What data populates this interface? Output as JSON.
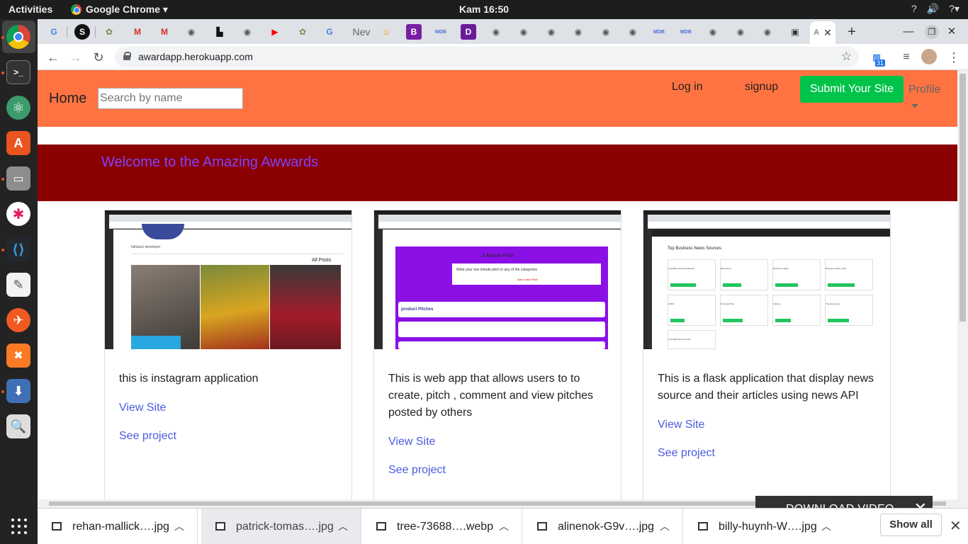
{
  "system": {
    "activities": "Activities",
    "app_name": "Google Chrome ▾",
    "clock": "Kam 16:50",
    "tray": [
      "?",
      "🔊",
      "?▾"
    ]
  },
  "browser": {
    "url": "awardapp.herokuapp.com",
    "tab_labels": [
      "G",
      "S",
      "M",
      "M",
      "G",
      "Nev",
      "B",
      "MDB",
      "MDB",
      "MDB"
    ],
    "badge": "31"
  },
  "page": {
    "nav": {
      "home": "Home",
      "search_placeholder": "Search by name",
      "login": "Log in",
      "signup": "signup",
      "submit": "Submit Your Site",
      "profile": "Profile"
    },
    "hero": {
      "welcome": "Welcome to the Amazing Awwards"
    },
    "projects": [
      {
        "description": "this is instagram application",
        "view_label": "View Site",
        "project_label": "See project",
        "thumb": {
          "all_posts": "All Posts",
          "subtitle": "fullstack developer"
        }
      },
      {
        "description": "This is web app that allows users to to create, pitch , comment and view pitches posted by others",
        "view_label": "View Site",
        "project_label": "See project",
        "thumb": {
          "title": "A Minute Pitch",
          "prompt": "Write your one minute pitch in any of the categories",
          "add": "Add a new Pitch",
          "section": "product Pitches"
        }
      },
      {
        "description": "This is a flask application that display news source and their articles using news API",
        "view_label": "View Site",
        "project_label": "See project",
        "thumb": {
          "title": "Top Business News Sources",
          "sources": [
            "Australian Financial Review",
            "Bloomberg",
            "Business Insider",
            "Business Insider (UK)",
            "CNBC",
            "Financial Post",
            "Fortune",
            "The Economist",
            "The Wall Street Journal"
          ]
        }
      }
    ]
  },
  "overlay": {
    "download_video": "DOWNLOAD VIDEO"
  },
  "downloads": {
    "items": [
      "rehan-mallick….jpg",
      "patrick-tomas….jpg",
      "tree-73688….webp",
      "alinenok-G9v….jpg",
      "billy-huynh-W….jpg"
    ],
    "show_all": "Show all"
  }
}
